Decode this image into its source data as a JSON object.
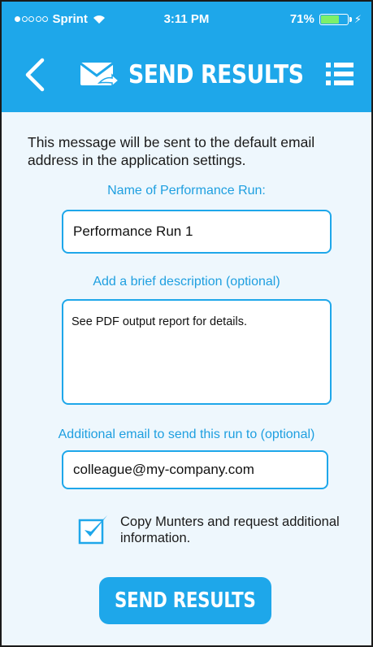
{
  "status_bar": {
    "carrier": "Sprint",
    "time": "3:11 PM",
    "battery": "71%",
    "battery_level": 0.71,
    "signal_bars_filled": 1,
    "signal_bars_total": 5
  },
  "header": {
    "title": "SEND RESULTS",
    "back_icon": "chevron-left-icon",
    "title_icon": "mail-send-icon",
    "menu_icon": "list-menu-icon"
  },
  "form": {
    "intro_text": "This message will be sent to the default email address in the application settings.",
    "run_name_label": "Name of Performance Run:",
    "run_name_value": "Performance Run 1",
    "description_label": "Add a brief description (optional)",
    "description_value": "See PDF output report for details.",
    "email_label": "Additional email to send this run to (optional)",
    "email_value": "colleague@my-company.com",
    "copy_checkbox_checked": true,
    "copy_checkbox_label": "Copy Munters and request additional information.",
    "submit_label": "SEND RESULTS"
  },
  "colors": {
    "accent": "#1ea7ea",
    "label_text": "#1e9fe0",
    "background": "#eef7fd",
    "battery_fill": "#7cf06a"
  }
}
